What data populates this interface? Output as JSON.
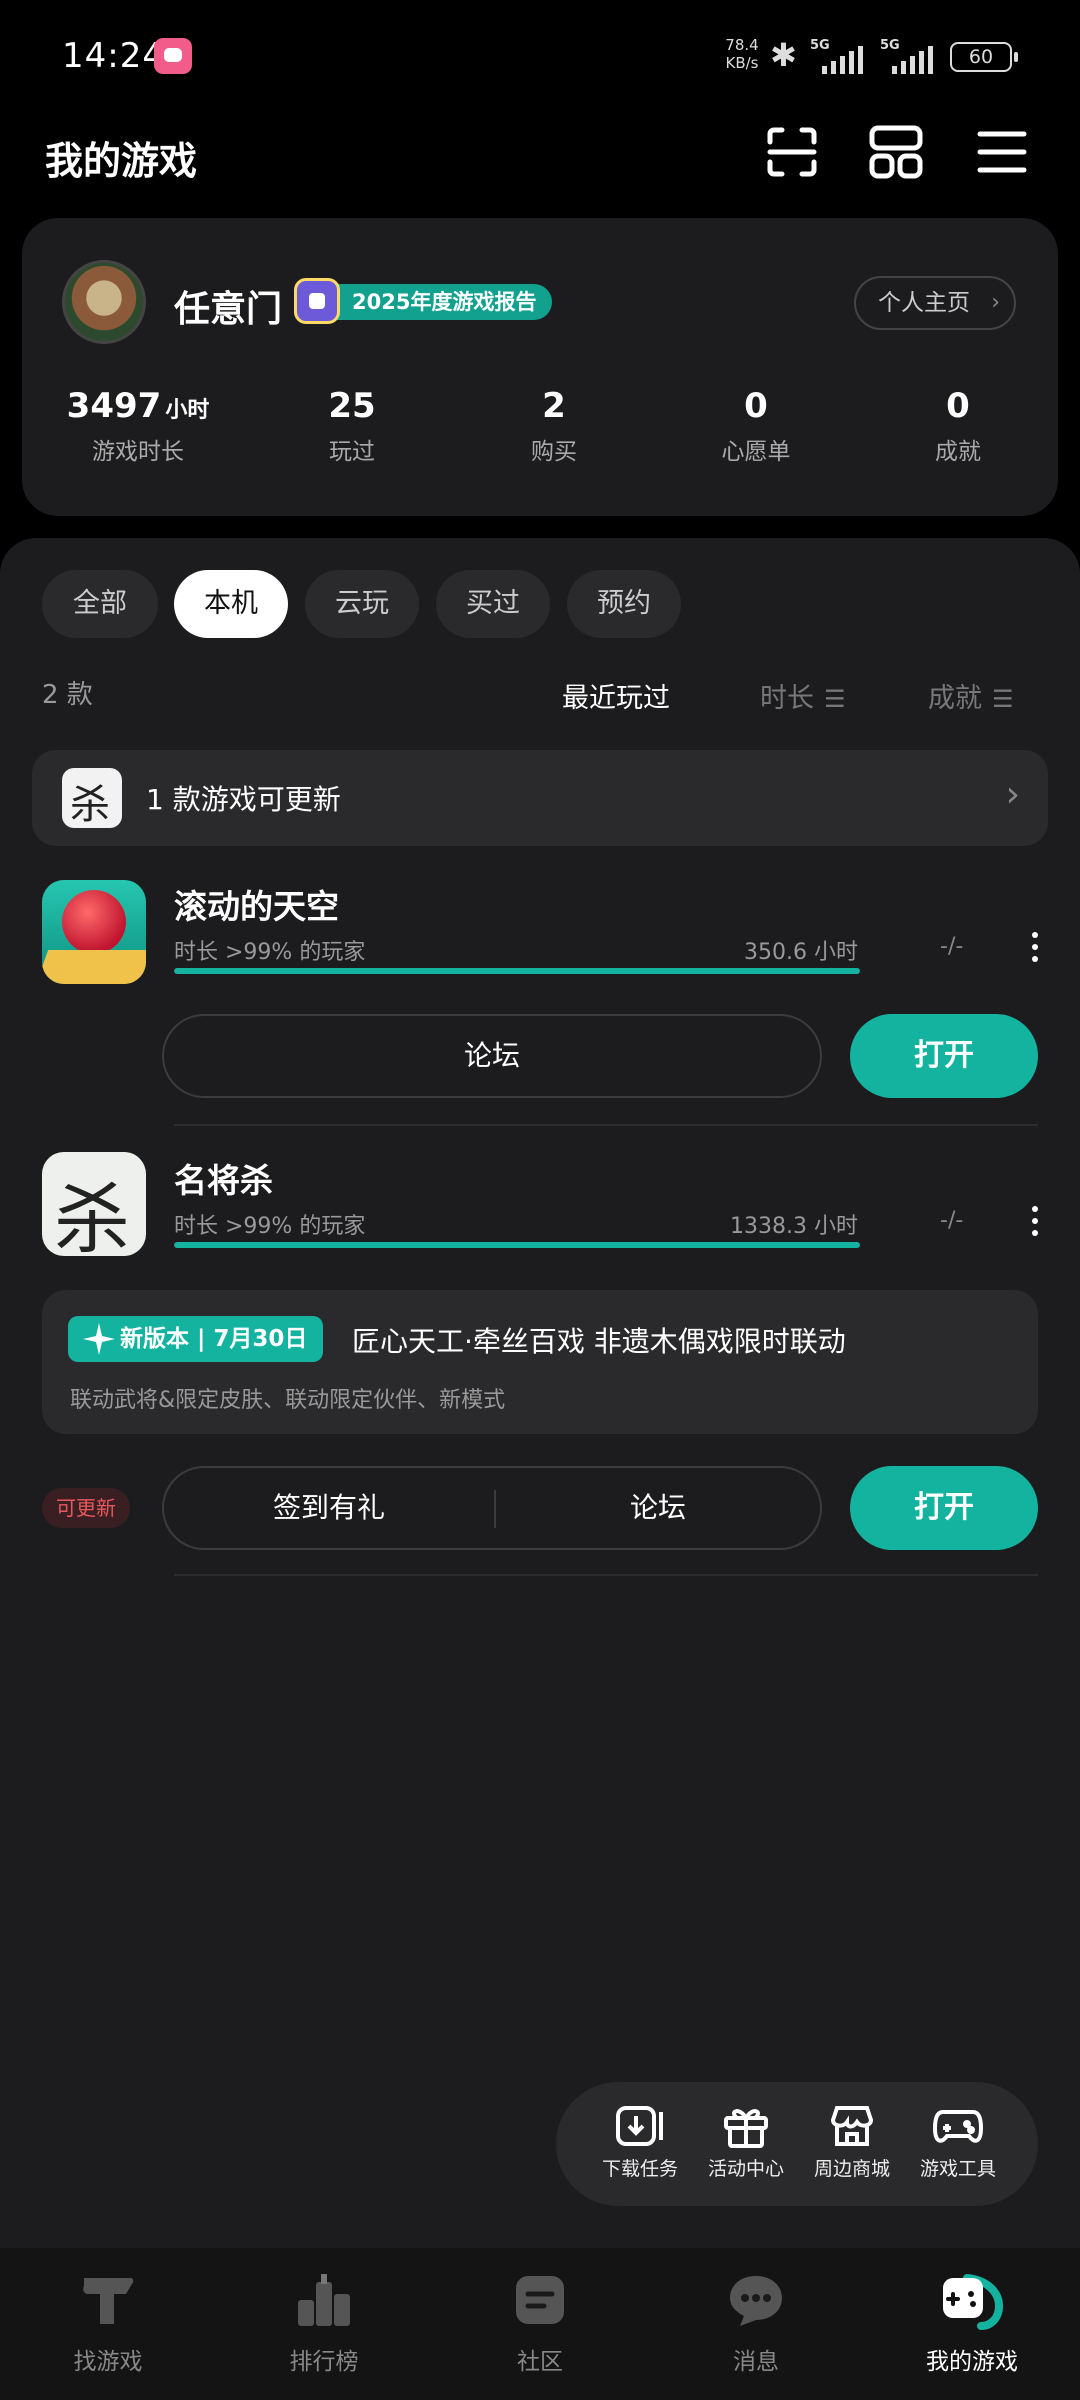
{
  "status_bar": {
    "time": "14:24",
    "net_speed_value": "78.4",
    "net_speed_unit": "KB/s",
    "sim1_label": "5G",
    "sim2_label": "5G",
    "battery": "60"
  },
  "header": {
    "title": "我的游戏",
    "icons": [
      "scan-icon",
      "grid-icon",
      "menu-icon"
    ]
  },
  "profile": {
    "name": "任意门",
    "report_badge": "2025年度游戏报告",
    "home_button": "个人主页",
    "stats": [
      {
        "value": "3497",
        "unit": "小时",
        "label": "游戏时长"
      },
      {
        "value": "25",
        "unit": "",
        "label": "玩过"
      },
      {
        "value": "2",
        "unit": "",
        "label": "购买"
      },
      {
        "value": "0",
        "unit": "",
        "label": "心愿单"
      },
      {
        "value": "0",
        "unit": "",
        "label": "成就"
      }
    ]
  },
  "filters": {
    "tabs": [
      "全部",
      "本机",
      "云玩",
      "买过",
      "预约"
    ],
    "active_index": 1
  },
  "list": {
    "count": "2 款",
    "sort_options": [
      "最近玩过",
      "时长",
      "成就"
    ],
    "active_sort": 0
  },
  "update_bar": {
    "text": "1 款游戏可更新"
  },
  "games": [
    {
      "name": "滚动的天空",
      "meta": "时长 >99% 的玩家",
      "hours": "350.6 小时",
      "progress": 1.0,
      "extra": "-/-",
      "buttons": [
        "论坛"
      ],
      "open_label": "打开"
    },
    {
      "name": "名将杀",
      "meta": "时长 >99% 的玩家",
      "hours": "1338.3 小时",
      "progress": 1.0,
      "extra": "-/-",
      "event": {
        "tag": "新版本 | 7月30日",
        "title": "匠心天工·牵丝百戏 非遗木偶戏限时联动",
        "subtitle": "联动武将&限定皮肤、联动限定伙伴、新模式"
      },
      "update_badge": "可更新",
      "buttons": [
        "签到有礼",
        "论坛"
      ],
      "open_label": "打开"
    }
  ],
  "float_tools": [
    {
      "label": "下载任务",
      "icon": "download-icon"
    },
    {
      "label": "活动中心",
      "icon": "gift-icon"
    },
    {
      "label": "周边商城",
      "icon": "store-icon"
    },
    {
      "label": "游戏工具",
      "icon": "gamepad-icon"
    }
  ],
  "bottom_nav": [
    {
      "label": "找游戏",
      "icon": "find-game-icon"
    },
    {
      "label": "排行榜",
      "icon": "ranking-icon"
    },
    {
      "label": "社区",
      "icon": "community-icon"
    },
    {
      "label": "消息",
      "icon": "message-icon"
    },
    {
      "label": "我的游戏",
      "icon": "my-games-icon"
    }
  ],
  "colors": {
    "accent": "#14b3a0",
    "background": "#000000",
    "panel": "#1c1c1e",
    "update_red": "#e8585c"
  }
}
